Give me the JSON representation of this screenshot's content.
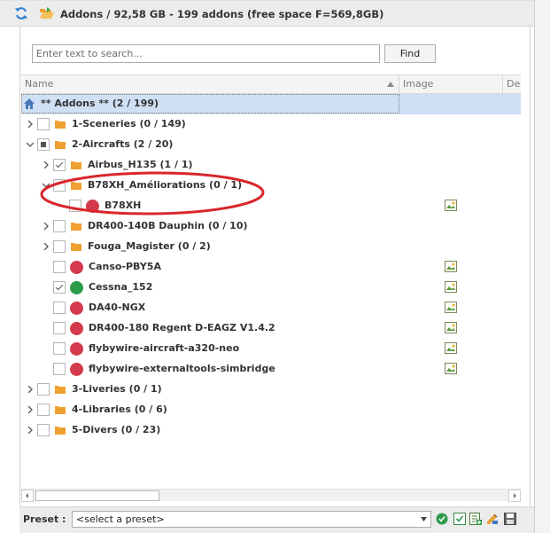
{
  "window": {
    "title": "Addons / 92,58 GB - 199 addons (free space F=569,8GB)"
  },
  "search": {
    "placeholder": "Enter text to search...",
    "value": "",
    "find_label": "Find"
  },
  "columns": {
    "name": "Name",
    "image": "Image",
    "description": "Desc"
  },
  "tree": {
    "root": "** Addons ** (2 / 199)",
    "items": [
      {
        "label": "1-Sceneries (0 / 149)",
        "type": "folder",
        "expander": "collapsed",
        "check": "unchecked"
      },
      {
        "label": "2-Aircrafts (2 / 20)",
        "type": "folder",
        "expander": "expanded",
        "check": "partial"
      },
      {
        "label": "Airbus_H135 (1 / 1)",
        "type": "folder",
        "expander": "collapsed",
        "check": "checked"
      },
      {
        "label": "B78XH_Améliorations (0 / 1)",
        "type": "folder",
        "expander": "expanded",
        "check": "unchecked"
      },
      {
        "label": "B78XH",
        "type": "addon",
        "status": "red",
        "check": "unchecked",
        "image": true
      },
      {
        "label": "DR400-140B Dauphin (0 / 10)",
        "type": "folder",
        "expander": "collapsed",
        "check": "unchecked"
      },
      {
        "label": "Fouga_Magister (0 / 2)",
        "type": "folder",
        "expander": "collapsed",
        "check": "unchecked"
      },
      {
        "label": "Canso-PBY5A",
        "type": "addon",
        "status": "red",
        "check": "unchecked",
        "image": true
      },
      {
        "label": "Cessna_152",
        "type": "addon",
        "status": "green",
        "check": "checked",
        "image": true
      },
      {
        "label": "DA40-NGX",
        "type": "addon",
        "status": "red",
        "check": "unchecked",
        "image": true
      },
      {
        "label": "DR400-180 Regent D-EAGZ V1.4.2",
        "type": "addon",
        "status": "red",
        "check": "unchecked",
        "image": true
      },
      {
        "label": "flybywire-aircraft-a320-neo",
        "type": "addon",
        "status": "red",
        "check": "unchecked",
        "image": true
      },
      {
        "label": "flybywire-externaltools-simbridge",
        "type": "addon",
        "status": "red",
        "check": "unchecked",
        "image": true
      },
      {
        "label": "3-Liveries (0 / 1)",
        "type": "folder",
        "expander": "collapsed",
        "check": "unchecked"
      },
      {
        "label": "4-Libraries (0 / 6)",
        "type": "folder",
        "expander": "collapsed",
        "check": "unchecked"
      },
      {
        "label": "5-Divers (0 / 23)",
        "type": "folder",
        "expander": "collapsed",
        "check": "unchecked"
      }
    ]
  },
  "preset": {
    "label": "Preset :",
    "selected": "<select a preset>"
  },
  "colors": {
    "folder": "#f0a030",
    "status_red": "#d33a4b",
    "status_green": "#2e9b4a",
    "selection": "#cfe0f5",
    "annotation": "#d9262c"
  }
}
